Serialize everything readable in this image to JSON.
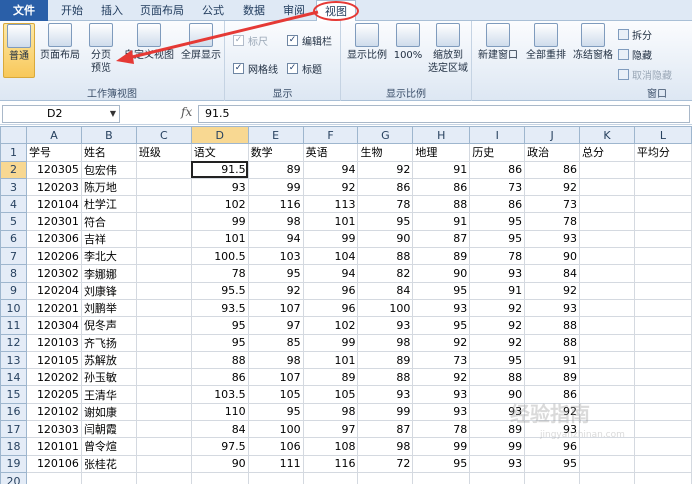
{
  "tabs": [
    {
      "label": "文件"
    },
    {
      "label": "开始"
    },
    {
      "label": "插入"
    },
    {
      "label": "页面布局"
    },
    {
      "label": "公式"
    },
    {
      "label": "数据"
    },
    {
      "label": "审阅"
    },
    {
      "label": "视图"
    }
  ],
  "ribbon": {
    "workbook_views": {
      "label": "工作簿视图",
      "normal": "普通",
      "page_layout": "页面布局",
      "page_break_line1": "分页",
      "page_break_line2": "预览",
      "custom_view": "自定义视图",
      "full_screen": "全屏显示"
    },
    "show": {
      "label": "显示",
      "ruler": "标尺",
      "formula_bar": "编辑栏",
      "gridlines": "网格线",
      "headings": "标题"
    },
    "zoom": {
      "label": "显示比例",
      "zoom": "显示比例",
      "hundred": "100%",
      "zoom_sel_line1": "缩放到",
      "zoom_sel_line2": "选定区域"
    },
    "window": {
      "label": "窗口",
      "new_window": "新建窗口",
      "arrange_all": "全部重排",
      "freeze_panes": "冻结窗格",
      "split": "拆分",
      "hide": "隐藏",
      "unhide": "取消隐藏"
    }
  },
  "formula_bar": {
    "name_box": "D2",
    "fx": "fx",
    "value": "91.5"
  },
  "grid": {
    "columns": [
      "A",
      "B",
      "C",
      "D",
      "E",
      "F",
      "G",
      "H",
      "I",
      "J",
      "K",
      "L"
    ],
    "rows": [
      [
        "学号",
        "姓名",
        "班级",
        "语文",
        "数学",
        "英语",
        "生物",
        "地理",
        "历史",
        "政治",
        "总分",
        "平均分"
      ],
      [
        "120305",
        "包宏伟",
        "",
        "91.5",
        "89",
        "94",
        "92",
        "91",
        "86",
        "86",
        "",
        ""
      ],
      [
        "120203",
        "陈万地",
        "",
        "93",
        "99",
        "92",
        "86",
        "86",
        "73",
        "92",
        "",
        ""
      ],
      [
        "120104",
        "杜学江",
        "",
        "102",
        "116",
        "113",
        "78",
        "88",
        "86",
        "73",
        "",
        ""
      ],
      [
        "120301",
        "符合",
        "",
        "99",
        "98",
        "101",
        "95",
        "91",
        "95",
        "78",
        "",
        ""
      ],
      [
        "120306",
        "吉祥",
        "",
        "101",
        "94",
        "99",
        "90",
        "87",
        "95",
        "93",
        "",
        ""
      ],
      [
        "120206",
        "李北大",
        "",
        "100.5",
        "103",
        "104",
        "88",
        "89",
        "78",
        "90",
        "",
        ""
      ],
      [
        "120302",
        "李娜娜",
        "",
        "78",
        "95",
        "94",
        "82",
        "90",
        "93",
        "84",
        "",
        ""
      ],
      [
        "120204",
        "刘康锋",
        "",
        "95.5",
        "92",
        "96",
        "84",
        "95",
        "91",
        "92",
        "",
        ""
      ],
      [
        "120201",
        "刘鹏举",
        "",
        "93.5",
        "107",
        "96",
        "100",
        "93",
        "92",
        "93",
        "",
        ""
      ],
      [
        "120304",
        "倪冬声",
        "",
        "95",
        "97",
        "102",
        "93",
        "95",
        "92",
        "88",
        "",
        ""
      ],
      [
        "120103",
        "齐飞扬",
        "",
        "95",
        "85",
        "99",
        "98",
        "92",
        "92",
        "88",
        "",
        ""
      ],
      [
        "120105",
        "苏解放",
        "",
        "88",
        "98",
        "101",
        "89",
        "73",
        "95",
        "91",
        "",
        ""
      ],
      [
        "120202",
        "孙玉敏",
        "",
        "86",
        "107",
        "89",
        "88",
        "92",
        "88",
        "89",
        "",
        ""
      ],
      [
        "120205",
        "王清华",
        "",
        "103.5",
        "105",
        "105",
        "93",
        "93",
        "90",
        "86",
        "",
        ""
      ],
      [
        "120102",
        "谢如康",
        "",
        "110",
        "95",
        "98",
        "99",
        "93",
        "93",
        "92",
        "",
        ""
      ],
      [
        "120303",
        "闫朝霞",
        "",
        "84",
        "100",
        "97",
        "87",
        "78",
        "89",
        "93",
        "",
        ""
      ],
      [
        "120101",
        "曾令煊",
        "",
        "97.5",
        "106",
        "108",
        "98",
        "99",
        "99",
        "96",
        "",
        ""
      ],
      [
        "120106",
        "张桂花",
        "",
        "90",
        "111",
        "116",
        "72",
        "95",
        "93",
        "95",
        "",
        ""
      ],
      [
        "",
        "",
        "",
        "",
        "",
        "",
        "",
        "",
        "",
        "",
        "",
        ""
      ],
      [
        "",
        "",
        "",
        "",
        "",
        "",
        "",
        "",
        "",
        "",
        "",
        ""
      ]
    ]
  },
  "watermark": {
    "line1": "经验指南",
    "line2": "jingyanzhinan.com"
  },
  "colors": {
    "annotation": "#e53935",
    "file_tab": "#2a5fa8",
    "selected_header": "#f8d892"
  }
}
